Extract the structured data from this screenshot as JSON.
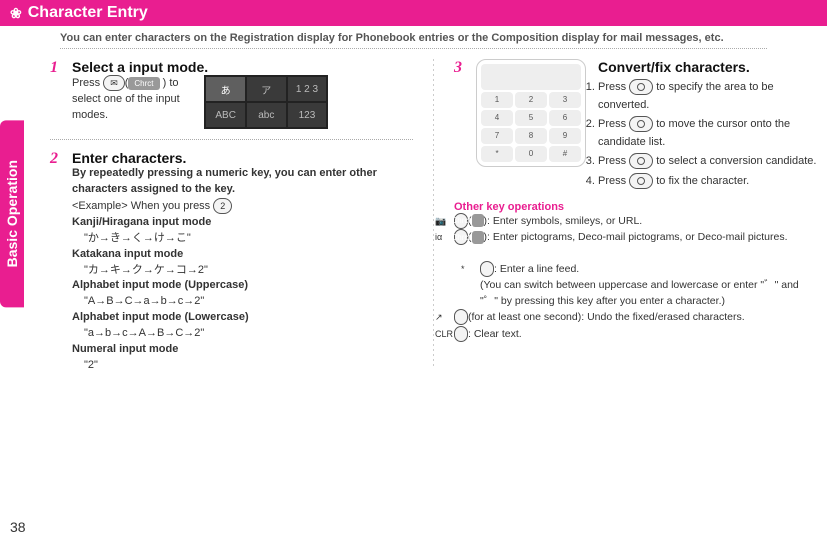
{
  "header": {
    "icon": "❀",
    "title": "Character Entry"
  },
  "subtitle": "You can enter characters on the Registration display for Phonebook entries or the Composition display for mail messages, etc.",
  "sidebar": {
    "label": "Basic Operation"
  },
  "step1": {
    "num": "1",
    "title": "Select a input mode.",
    "body_a": "Press ",
    "key_icon": "✉",
    "key_label": "Chrct",
    "body_b": ") to select one of the input modes.",
    "screen": [
      "あ",
      "ア",
      "1 2 3",
      "ABC",
      "abc",
      "123"
    ]
  },
  "step2": {
    "num": "2",
    "title": "Enter characters.",
    "lead": "By repeatedly pressing a numeric key, you can enter other characters assigned to the key.",
    "example_label": "<Example> When you press ",
    "example_key": "2",
    "modes": [
      {
        "name": "Kanji/Hiragana input mode",
        "seq": "\"か→き→く→け→こ\""
      },
      {
        "name": "Katakana input mode",
        "seq": "\"カ→キ→ク→ケ→コ→2\""
      },
      {
        "name": "Alphabet input mode (Uppercase)",
        "seq": "\"A→B→C→a→b→c→2\""
      },
      {
        "name": "Alphabet input mode (Lowercase)",
        "seq": "\"a→b→c→A→B→C→2\""
      },
      {
        "name": "Numeral input mode",
        "seq": "\"2\""
      }
    ]
  },
  "step3": {
    "num": "3",
    "title": "Convert/fix characters.",
    "items": [
      "Press ⬤ to specify the area to be converted.",
      "Press ⬤ to move the cursor onto the candidate list.",
      "Press ⬤ to select a conversion candidate.",
      "Press ⬤ to fix the character."
    ]
  },
  "other": {
    "heading": "Other key operations",
    "rows": [
      {
        "key": "📷",
        "label": "Chrct",
        "text": "): Enter symbols, smileys, or URL."
      },
      {
        "key": "iα",
        "label": "Chrct",
        "text": "): Enter pictograms, Deco-mail pictograms, or Deco-mail pictures."
      },
      {
        "key": "*",
        "text": ": Enter a line feed.\n(You can switch between uppercase and lowercase or enter \"゛\" and \"゜\" by pressing this key after you enter a character.)"
      },
      {
        "key": "↗",
        "text": "(for at least one second): Undo the fixed/erased characters."
      },
      {
        "key": "CLR",
        "text": ": Clear text."
      }
    ]
  },
  "page": "38",
  "keypad": [
    "1",
    "2",
    "3",
    "4",
    "5",
    "6",
    "7",
    "8",
    "9",
    "*",
    "0",
    "#"
  ]
}
